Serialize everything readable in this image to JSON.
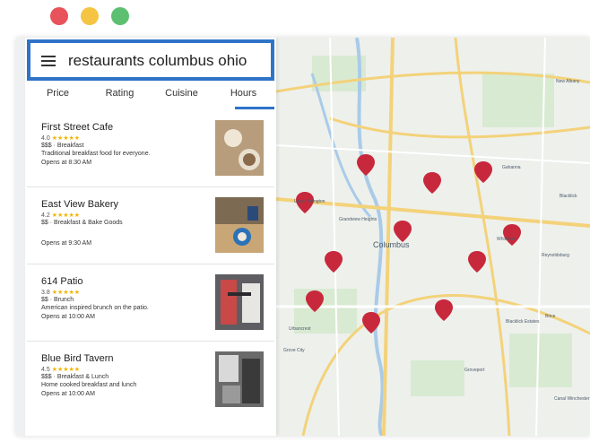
{
  "window": {
    "traffic_lights": {
      "close": "#e8525a",
      "minimize": "#f5c443",
      "maximize": "#5dbf70"
    }
  },
  "search": {
    "query": "restaurants columbus ohio",
    "menu_icon": "hamburger-menu-icon"
  },
  "filters": [
    "Price",
    "Rating",
    "Cuisine",
    "Hours"
  ],
  "active_filter": "Hours",
  "results": [
    {
      "name": "First Street Cafe",
      "rating": "4.0",
      "stars": "★★★★★",
      "price": "$$$ · Breakfast",
      "description": "Traditional breakfast food for everyone.",
      "hours": "Opens at 8:30 AM"
    },
    {
      "name": "East View Bakery",
      "rating": "4.2",
      "stars": "★★★★★",
      "price": "$$ · Breakfast & Bake Goods",
      "description": "",
      "hours": "Opens at 9:30 AM"
    },
    {
      "name": "614 Patio",
      "rating": "3.8",
      "stars": "★★★★★",
      "price": "$$ · Brunch",
      "description": "American inspired brunch on the patio.",
      "hours": "Opens at 10:00 AM"
    },
    {
      "name": "Blue Bird Tavern",
      "rating": "4.5",
      "stars": "★★★★★",
      "price": "$$$ · Breakfast & Lunch",
      "description": "Home cooked breakfast and lunch",
      "hours": "Opens at 10:00 AM"
    }
  ],
  "map": {
    "city_label": "Columbus",
    "place_labels": [
      "Upper Arlington",
      "Grandview Heights",
      "Gahanna",
      "Whitehall",
      "Reynoldsburg",
      "Urbancrest",
      "Grove City",
      "Blacklick Estates",
      "Brice",
      "Canal Winchester",
      "New Albany",
      "Blacklick",
      "Groveport"
    ],
    "pin_color": "#c8283c"
  }
}
